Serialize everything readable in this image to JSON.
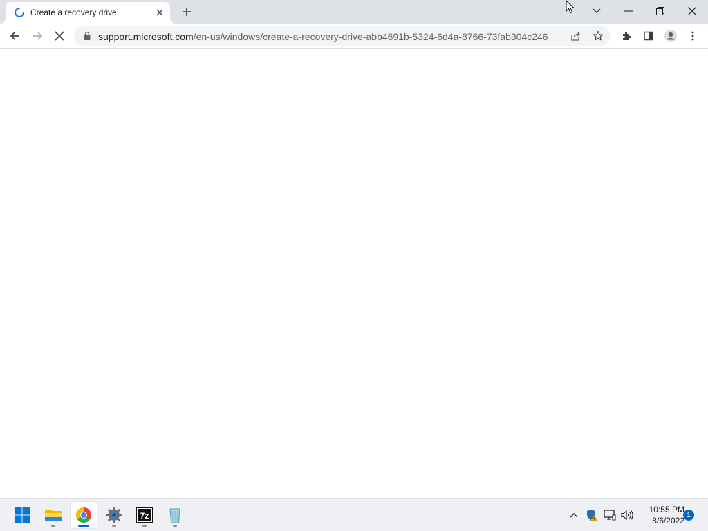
{
  "browser": {
    "tab": {
      "title": "Create a recovery drive",
      "loading": true
    },
    "new_tab_icon": "plus-icon",
    "window_controls": [
      "tab-search-icon",
      "minimize-icon",
      "restore-icon",
      "close-icon"
    ],
    "toolbar": {
      "back_icon": "arrow-left-icon",
      "forward_icon": "arrow-right-icon",
      "stop_icon": "stop-loading-icon",
      "url_host": "support.microsoft.com",
      "url_path": "/en-us/windows/create-a-recovery-drive-abb4691b-5324-6d4a-8766-73fab304c246",
      "omnibox_icons": [
        "share-icon",
        "bookmark-star-icon"
      ],
      "right_icons": [
        "extensions-icon",
        "side-panel-icon",
        "profile-icon",
        "menu-icon"
      ]
    }
  },
  "taskbar": {
    "apps": [
      {
        "name": "start",
        "icon": "windows-start-icon"
      },
      {
        "name": "file-explorer",
        "icon": "folder-icon"
      },
      {
        "name": "chrome",
        "icon": "chrome-icon",
        "active": true
      },
      {
        "name": "settings",
        "icon": "settings-gear-icon"
      },
      {
        "name": "7zip",
        "icon": "7zip-icon"
      },
      {
        "name": "recycle-bin",
        "icon": "recycle-bin-icon"
      }
    ],
    "tray": {
      "icons": [
        "chevron-up-icon",
        "windows-security-icon",
        "network-icon",
        "volume-icon"
      ],
      "time": "10:55 PM",
      "date": "8/6/2022",
      "notification_count": "1"
    }
  },
  "colors": {
    "titlebar": "#dee1e6",
    "accent": "#0067c0",
    "chrome_red": "#ea4335",
    "chrome_green": "#34a853",
    "chrome_yellow": "#fbbc05",
    "chrome_blue": "#4285f4"
  }
}
